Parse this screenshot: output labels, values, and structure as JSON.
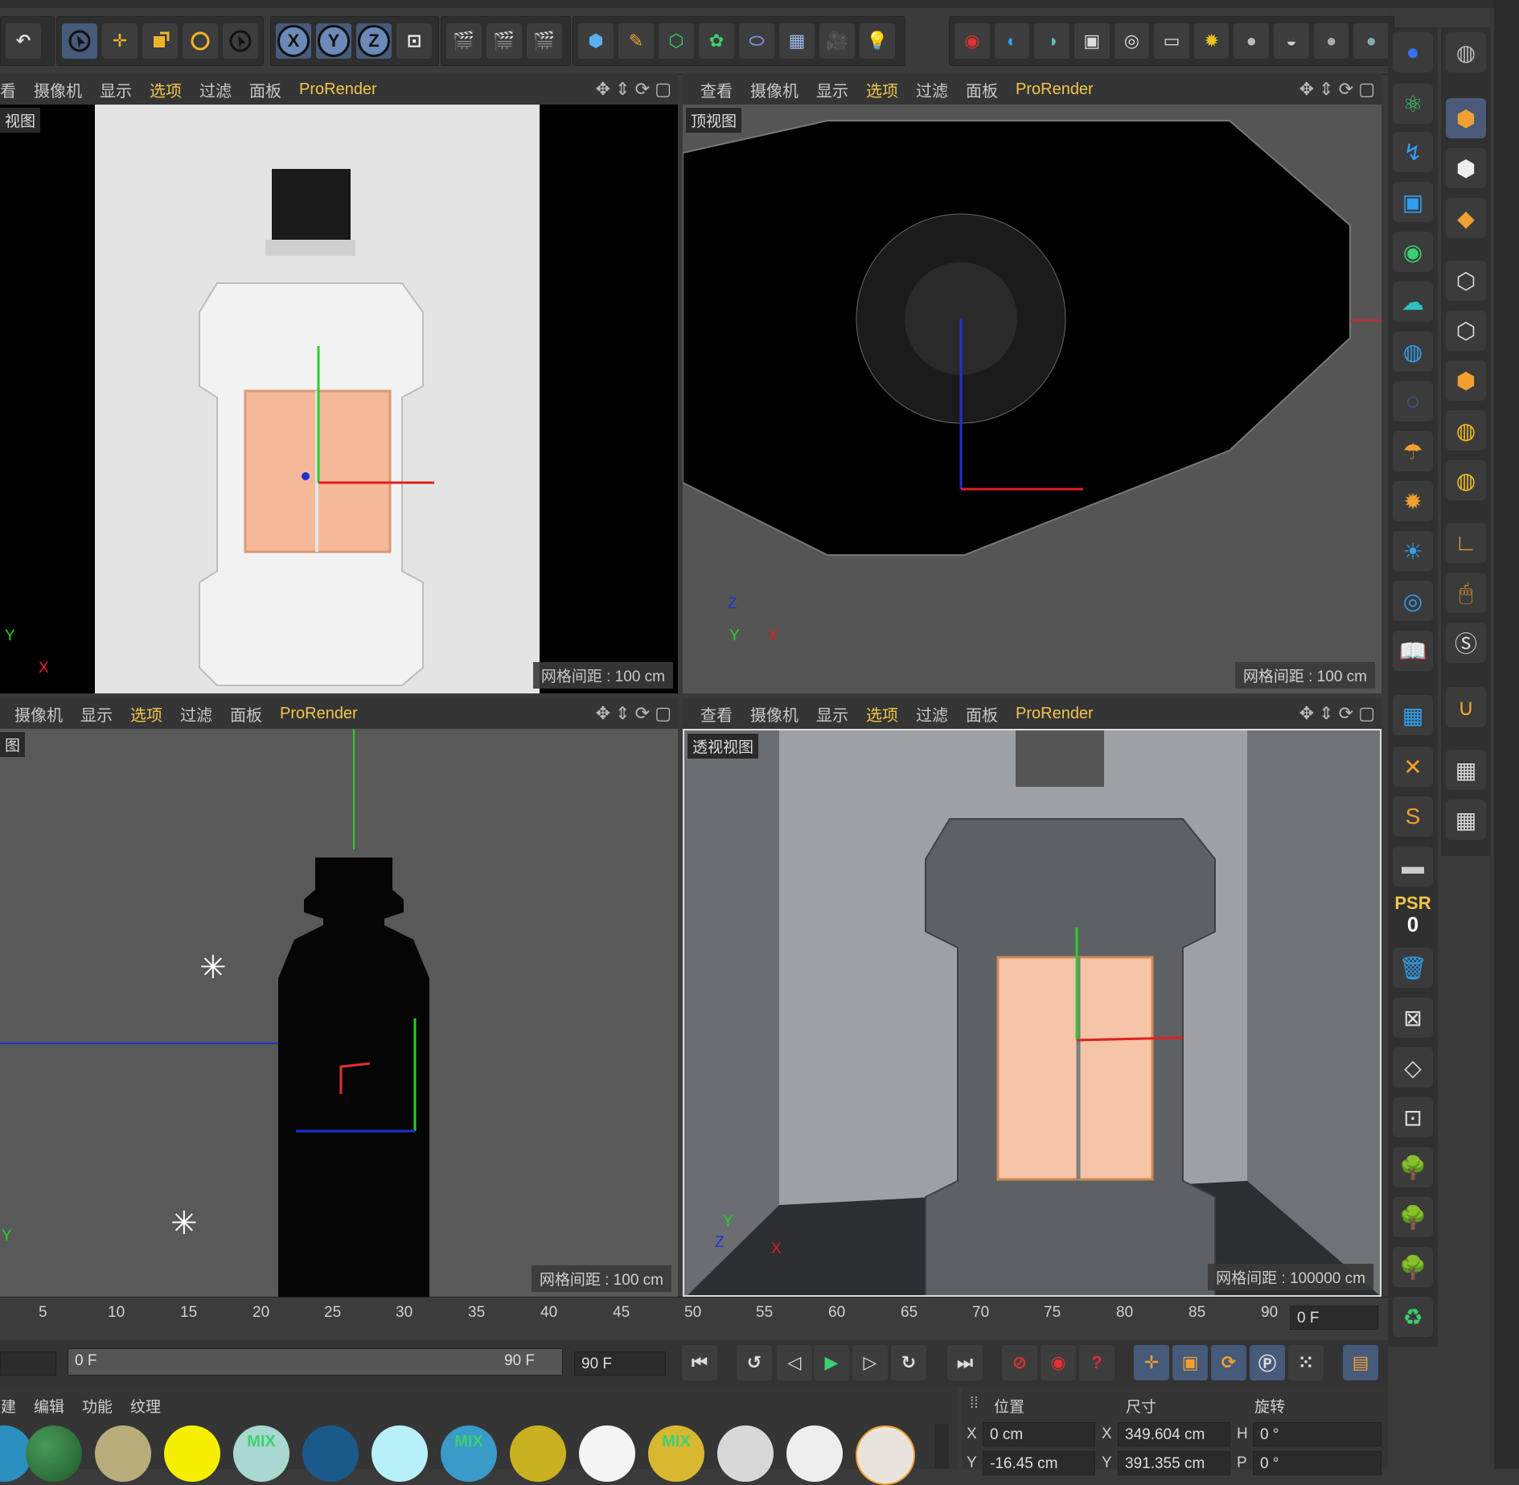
{
  "toolbar": {
    "axis_x": "X",
    "axis_y": "Y",
    "axis_z": "Z"
  },
  "viewport_menu": {
    "items": [
      "查看",
      "摄像机",
      "显示",
      "选项",
      "过滤",
      "面板"
    ],
    "prorender": "ProRender"
  },
  "viewports": {
    "top_left": {
      "label": "视图",
      "grid": "网格间距 : 100 cm",
      "axis_v": "Y",
      "axis_h": "X"
    },
    "top_right": {
      "label": "顶视图",
      "grid": "网格间距 : 100 cm",
      "axis_v": "Z",
      "axis_h": "X",
      "axis_sub": "Y"
    },
    "bottom_left": {
      "label": "图",
      "grid": "网格间距 : 100 cm",
      "axis_v": "Y"
    },
    "bottom_right": {
      "label": "透视视图",
      "grid": "网格间距 : 100000 cm",
      "axis_v": "Y",
      "axis_h": "X",
      "axis_sub": "Z"
    }
  },
  "timeline": {
    "ticks": [
      "5",
      "10",
      "15",
      "20",
      "25",
      "30",
      "35",
      "40",
      "45",
      "50",
      "55",
      "60",
      "65",
      "70",
      "75",
      "80",
      "85",
      "90"
    ],
    "current_frame": "0 F",
    "range_start": "0 F",
    "range_end": "90 F",
    "end_frame": "90 F"
  },
  "palette": {
    "psr_label": "PSR",
    "psr_value": "0"
  },
  "material_menu": {
    "items": [
      "创建",
      "编辑",
      "功能",
      "纹理"
    ],
    "mix_label": "MIX"
  },
  "coords": {
    "header_position": "位置",
    "header_size": "尺寸",
    "header_rotation": "旋转",
    "row1": {
      "x_label": "X",
      "x_val": "0 cm",
      "sx_label": "X",
      "sx_val": "349.604 cm",
      "h_label": "H",
      "h_val": "0 °"
    },
    "row2": {
      "y_label": "Y",
      "y_val": "-16.45 cm",
      "sy_label": "Y",
      "sy_val": "391.355 cm",
      "p_label": "P",
      "p_val": "0 °"
    }
  },
  "colors": {
    "accent": "#f0c64a",
    "label_panel": "#f3b99a"
  }
}
